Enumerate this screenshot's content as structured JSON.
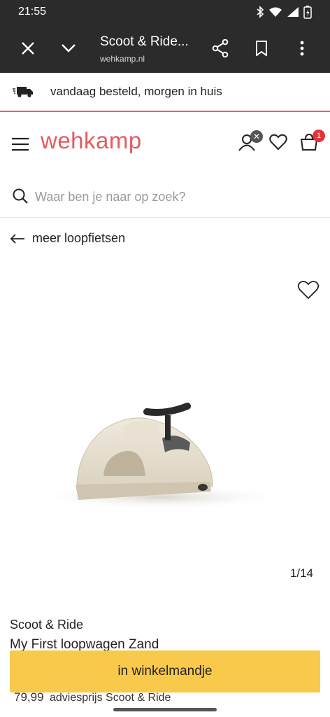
{
  "status_bar": {
    "time": "21:55"
  },
  "browser": {
    "tab_title": "Scoot & Ride...",
    "url": "wehkamp.nl"
  },
  "promo": {
    "text": "vandaag besteld, morgen in huis"
  },
  "header": {
    "logo": "wehkamp",
    "account_badge": "✕",
    "cart_count": "1"
  },
  "search": {
    "placeholder": "Waar ben je naar op zoek?"
  },
  "breadcrumb": {
    "back_label": "meer loopfietsen"
  },
  "gallery": {
    "counter": "1/14"
  },
  "product": {
    "brand": "Scoot & Ride",
    "title": "My First loopwagen Zand",
    "price": "79,99",
    "price_note": "adviesprijs Scoot & Ride"
  },
  "cart_button": {
    "label": "in winkelmandje"
  },
  "colors": {
    "brand": "#e45b5f",
    "cta": "#f9c94b",
    "badge": "#e0353b",
    "chrome": "#2b2b2b"
  }
}
